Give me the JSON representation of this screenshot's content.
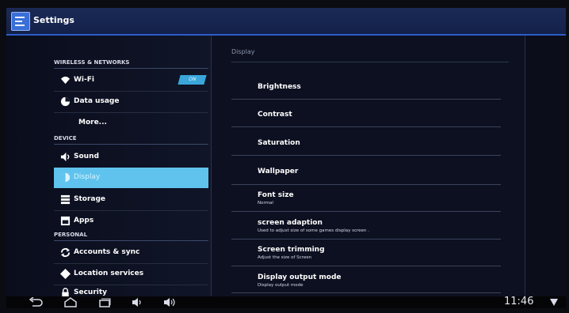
{
  "titlebar": {
    "title": "Settings"
  },
  "sections": {
    "wireless": "WIRELESS & NETWORKS",
    "device": "DEVICE",
    "personal": "PERSONAL"
  },
  "sidebar": {
    "wifi": {
      "label": "Wi-Fi",
      "icon": "wifi-icon",
      "toggle": "ON"
    },
    "data_usage": {
      "label": "Data usage",
      "icon": "data-usage-icon"
    },
    "more": {
      "label": "More..."
    },
    "sound": {
      "label": "Sound",
      "icon": "speaker-icon"
    },
    "display": {
      "label": "Display",
      "icon": "brightness-icon",
      "selected": true
    },
    "storage": {
      "label": "Storage",
      "icon": "storage-icon"
    },
    "apps": {
      "label": "Apps",
      "icon": "apps-icon"
    },
    "accounts": {
      "label": "Accounts & sync",
      "icon": "sync-icon"
    },
    "location": {
      "label": "Location services",
      "icon": "location-icon"
    },
    "security": {
      "label": "Security",
      "icon": "lock-icon"
    }
  },
  "main": {
    "header": "Display",
    "rows": [
      {
        "title": "Brightness",
        "subtitle": ""
      },
      {
        "title": "Contrast",
        "subtitle": ""
      },
      {
        "title": "Saturation",
        "subtitle": ""
      },
      {
        "title": "Wallpaper",
        "subtitle": ""
      },
      {
        "title": "Font size",
        "subtitle": "Normal"
      },
      {
        "title": "screen adaption",
        "subtitle": "Used to adjust size of some games display screen ."
      },
      {
        "title": "Screen trimming",
        "subtitle": "Adjust the size of Screen"
      },
      {
        "title": "Display output mode",
        "subtitle": "Display output mode"
      }
    ]
  },
  "navbar": {
    "back_icon": "back-icon",
    "home_icon": "home-icon",
    "recents_icon": "recents-icon",
    "vol_down_icon": "volume-down-icon",
    "vol_up_icon": "volume-up-icon",
    "time": "11:46"
  },
  "colors": {
    "accent": "#5fc3ed",
    "titlebar": "#1a2a55"
  }
}
